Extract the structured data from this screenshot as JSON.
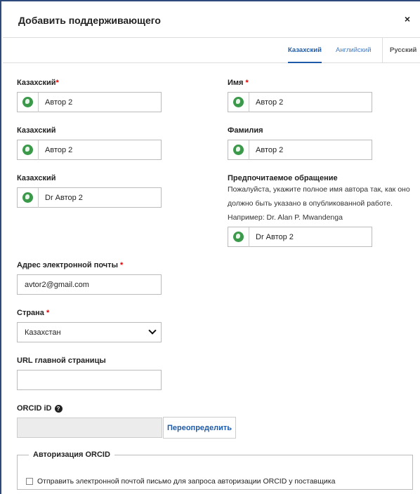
{
  "dialog": {
    "title": "Добавить поддерживающего",
    "close": "×"
  },
  "tabs": [
    {
      "label": "Казахский",
      "active": true
    },
    {
      "label": "Английский",
      "active": false
    },
    {
      "label": "Русский",
      "active": false
    }
  ],
  "left": {
    "field1": {
      "label": "Казахский",
      "required_mark": "*",
      "value": "Автор 2"
    },
    "field2": {
      "label": "Казахский",
      "value": "Автор 2"
    },
    "field3": {
      "label": "Казахский",
      "value": "Dr Автор 2"
    }
  },
  "right": {
    "given_name": {
      "label": "Имя",
      "required_mark": "*",
      "value": "Автор 2"
    },
    "family_name": {
      "label": "Фамилия",
      "value": "Автор 2"
    },
    "preferred": {
      "label": "Предпочитаемое обращение",
      "description": "Пожалуйста, укажите полное имя автора так, как оно должно быть указано в опубликованной работе. Например: Dr. Alan P. Mwandenga",
      "value": "Dr Автор 2"
    }
  },
  "email": {
    "label": "Адрес электронной почты",
    "required_mark": "*",
    "value": "avtor2@gmail.com"
  },
  "country": {
    "label": "Страна",
    "required_mark": "*",
    "value": "Казахстан"
  },
  "homepage": {
    "label": "URL главной страницы",
    "value": ""
  },
  "orcid": {
    "label": "ORCID iD",
    "help_icon": "?",
    "value": "",
    "override_label": "Переопределить"
  },
  "orcid_auth": {
    "legend": "Авторизация ORCID",
    "checkbox_label": "Отправить электронной почтой письмо для запроса авторизации ORCID у поставщика"
  },
  "colors": {
    "accent": "#1e5aa8",
    "required": "#d00000",
    "globe": "#3a9a4a",
    "frame": "#2e4a7d"
  }
}
